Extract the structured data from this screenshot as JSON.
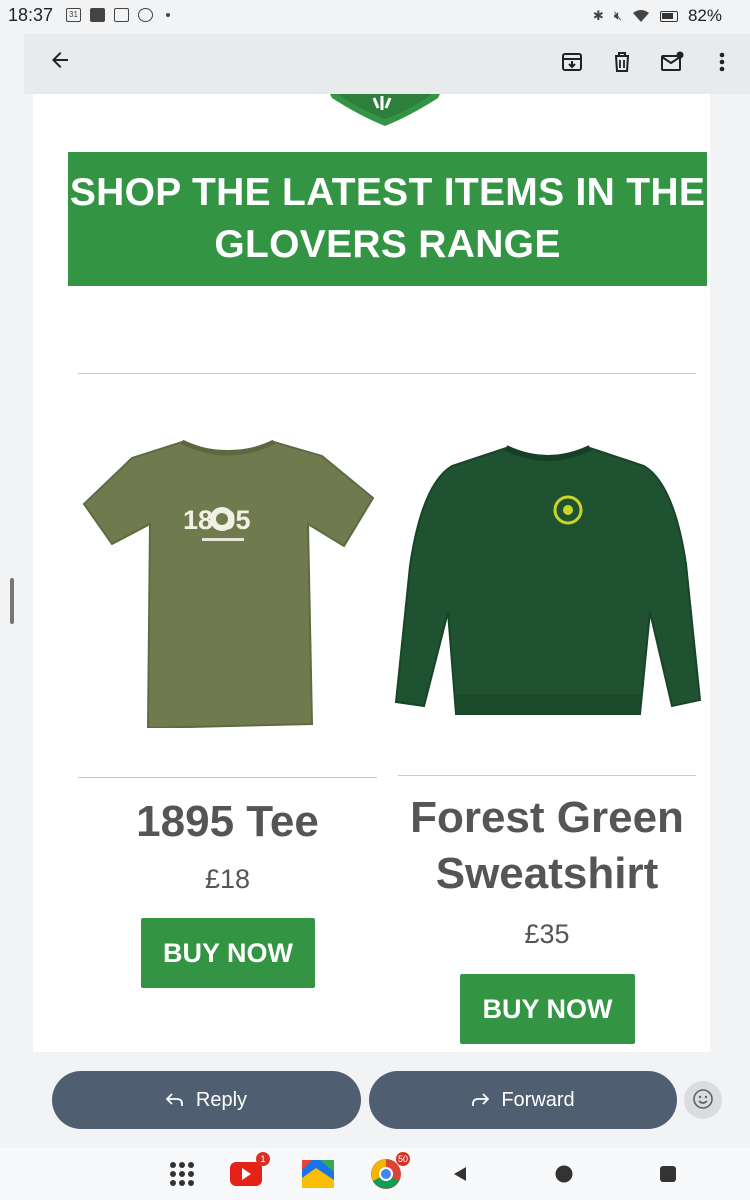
{
  "status_bar": {
    "time": "18:37",
    "battery": "82%",
    "left_icons": [
      "calendar-icon",
      "youtube-icon",
      "photos-icon",
      "chrome-icon"
    ],
    "calendar_day": "31"
  },
  "app_bar": {
    "actions": [
      "archive-icon",
      "delete-icon",
      "mark-unread-icon",
      "more-icon"
    ]
  },
  "email": {
    "banner_title": "SHOP THE LATEST ITEMS IN THE GLOVERS RANGE",
    "products": [
      {
        "name": "1895 Tee",
        "price": "£18",
        "button": "BUY NOW",
        "print_text": "18  95"
      },
      {
        "name": "Forest Green Sweatshirt",
        "price": "£35",
        "button": "BUY NOW"
      }
    ]
  },
  "reply_bar": {
    "reply_label": "Reply",
    "forward_label": "Forward"
  },
  "nav_bar": {
    "youtube_badge": "1",
    "chrome_badge": "50"
  },
  "colors": {
    "brand_green": "#339543",
    "pill_bg": "#4f5e70",
    "tee_color": "#6f7b4f",
    "sweatshirt_color": "#1f5230"
  }
}
